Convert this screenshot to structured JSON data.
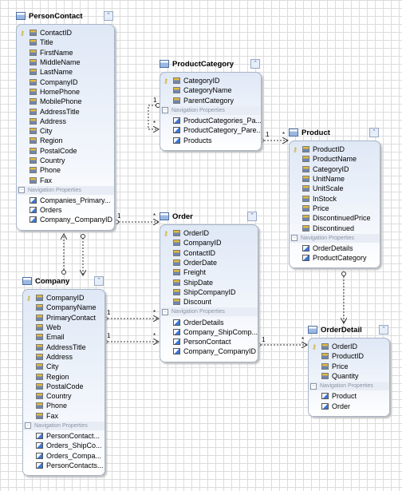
{
  "entities": {
    "personcontact": {
      "title": "PersonContact",
      "properties": [
        "ContactID",
        "Title",
        "FirstName",
        "MiddleName",
        "LastName",
        "CompanyID",
        "HomePhone",
        "MobilePhone",
        "AddressTitle",
        "Address",
        "City",
        "Region",
        "PostalCode",
        "Country",
        "Phone",
        "Fax"
      ],
      "nav_label": "Navigation Properties",
      "nav": [
        "Companies_Primary...",
        "Orders",
        "Company_CompanyID"
      ]
    },
    "productcategory": {
      "title": "ProductCategory",
      "properties": [
        "CategoryID",
        "CategoryName",
        "ParentCategory"
      ],
      "nav_label": "Navigation Properties",
      "nav": [
        "ProductCategories_Pa...",
        "ProductCategory_Pare...",
        "Products"
      ]
    },
    "product": {
      "title": "Product",
      "properties": [
        "ProductID",
        "ProductName",
        "CategoryID",
        "UnitName",
        "UnitScale",
        "InStock",
        "Price",
        "DiscontinuedPrice",
        "Discontinued"
      ],
      "nav_label": "Navigation Properties",
      "nav": [
        "OrderDetails",
        "ProductCategory"
      ]
    },
    "order": {
      "title": "Order",
      "properties": [
        "OrderID",
        "CompanyID",
        "ContactID",
        "OrderDate",
        "Freight",
        "ShipDate",
        "ShipCompanyID",
        "Discount"
      ],
      "nav_label": "Navigation Properties",
      "nav": [
        "OrderDetails",
        "Company_ShipComp...",
        "PersonContact",
        "Company_CompanyID"
      ]
    },
    "company": {
      "title": "Company",
      "properties": [
        "CompanyID",
        "CompanyName",
        "PrimaryContact",
        "Web",
        "Email",
        "AddressTitle",
        "Address",
        "City",
        "Region",
        "PostalCode",
        "Country",
        "Phone",
        "Fax"
      ],
      "nav_label": "Navigation Properties",
      "nav": [
        "PersonContact...",
        "Orders_ShipCo...",
        "Orders_Compa...",
        "PersonContacts..."
      ]
    },
    "orderdetail": {
      "title": "OrderDetail",
      "properties": [
        "OrderID",
        "ProductID",
        "Price",
        "Quantity"
      ],
      "nav_label": "Navigation Properties",
      "nav": [
        "Product",
        "Order"
      ]
    }
  },
  "multiplicity": {
    "one": "1",
    "many": "*"
  },
  "icons": {
    "entity": "entity-icon",
    "key": "key-icon",
    "property": "property-icon",
    "navigation": "navigation-property-icon",
    "collapse": "collapse-chevron-icon"
  }
}
